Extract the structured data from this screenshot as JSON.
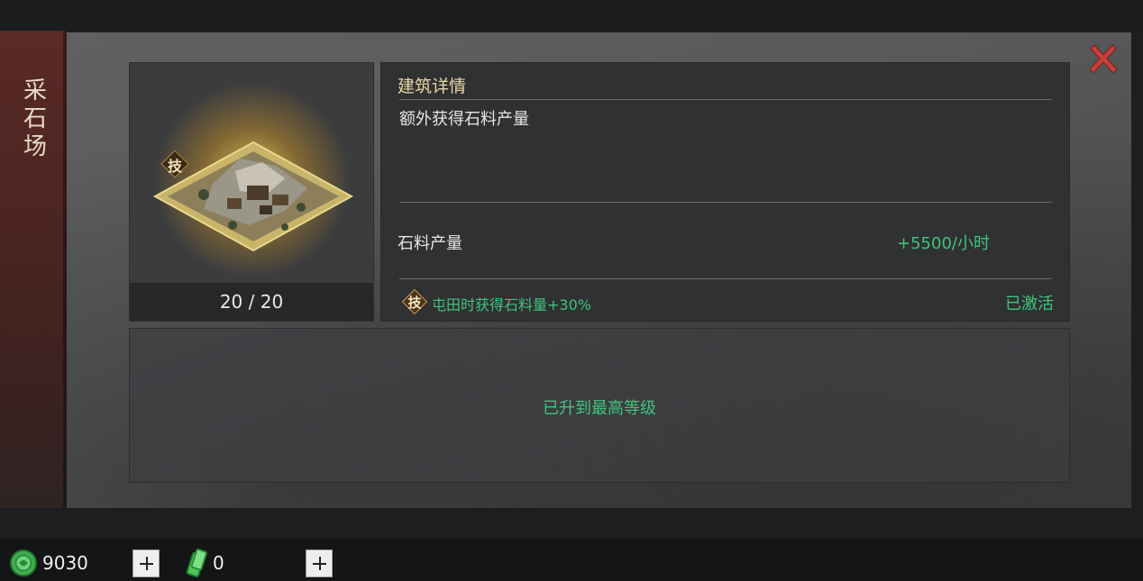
{
  "side_tab": {
    "title_chars": [
      "采",
      "石",
      "场"
    ]
  },
  "close_button": {
    "icon": "close-x-icon",
    "color": "#c8403c"
  },
  "building": {
    "image": "quarry-building-icon",
    "skill_badge": "技",
    "level_text": "20 / 20"
  },
  "detail": {
    "title": "建筑详情",
    "description": "额外获得石料产量",
    "stat_label": "石料产量",
    "stat_value": "+5500/小时",
    "tech_badge": "技",
    "tech_effect": "屯田时获得石料量+30%",
    "tech_status": "已激活"
  },
  "upgrade": {
    "message": "已升到最高等级"
  },
  "resources": {
    "jade": {
      "icon": "jade-coin-icon",
      "value": "9030"
    },
    "token": {
      "icon": "green-token-icon",
      "value": "0"
    }
  },
  "colors": {
    "accent_green": "#3fc47c",
    "title_gold": "#e8d7a8"
  }
}
